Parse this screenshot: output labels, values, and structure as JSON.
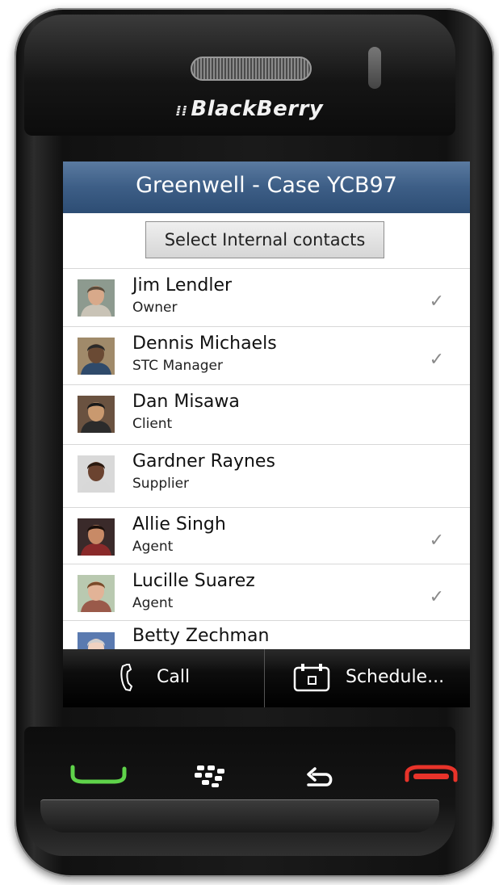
{
  "device": {
    "brand": "BlackBerry"
  },
  "header": {
    "title": "Greenwell - Case YCB97"
  },
  "select_button": {
    "label": "Select Internal contacts"
  },
  "contacts": [
    {
      "name": "Jim Lendler",
      "role": "Owner",
      "checked": true,
      "skin": "#d8a98a",
      "hair": "#5a4a3a",
      "shirt": "#c9c3b6",
      "bg": "#8d9a8f"
    },
    {
      "name": "Dennis Michaels",
      "role": "STC Manager",
      "checked": true,
      "skin": "#6a4a34",
      "hair": "#2a2a2a",
      "shirt": "#2f4a6a",
      "bg": "#a08a6a"
    },
    {
      "name": "Dan Misawa",
      "role": "Client",
      "checked": false,
      "skin": "#c9996f",
      "hair": "#1a1a1a",
      "shirt": "#2b2b2b",
      "bg": "#6a5240"
    },
    {
      "name": "Gardner Raynes",
      "role": "Supplier",
      "checked": false,
      "skin": "#6b4330",
      "hair": "#2a1a10",
      "shirt": "#d8d8d8",
      "bg": "#d9d9d9"
    },
    {
      "name": "Allie Singh",
      "role": "Agent",
      "checked": true,
      "skin": "#c88a66",
      "hair": "#1a0f0a",
      "shirt": "#8a2a2a",
      "bg": "#3a2a2a"
    },
    {
      "name": "Lucille Suarez",
      "role": "Agent",
      "checked": true,
      "skin": "#e2b397",
      "hair": "#7a4a2a",
      "shirt": "#9a5a4a",
      "bg": "#b9c9b0"
    },
    {
      "name": "Betty Zechman",
      "role": "",
      "checked": false,
      "skin": "#f0d2c0",
      "hair": "#cfcfcf",
      "shirt": "#4a5a8a",
      "bg": "#5a7ab0"
    }
  ],
  "check_glyph": "✓",
  "actions": {
    "call": "Call",
    "schedule": "Schedule..."
  }
}
